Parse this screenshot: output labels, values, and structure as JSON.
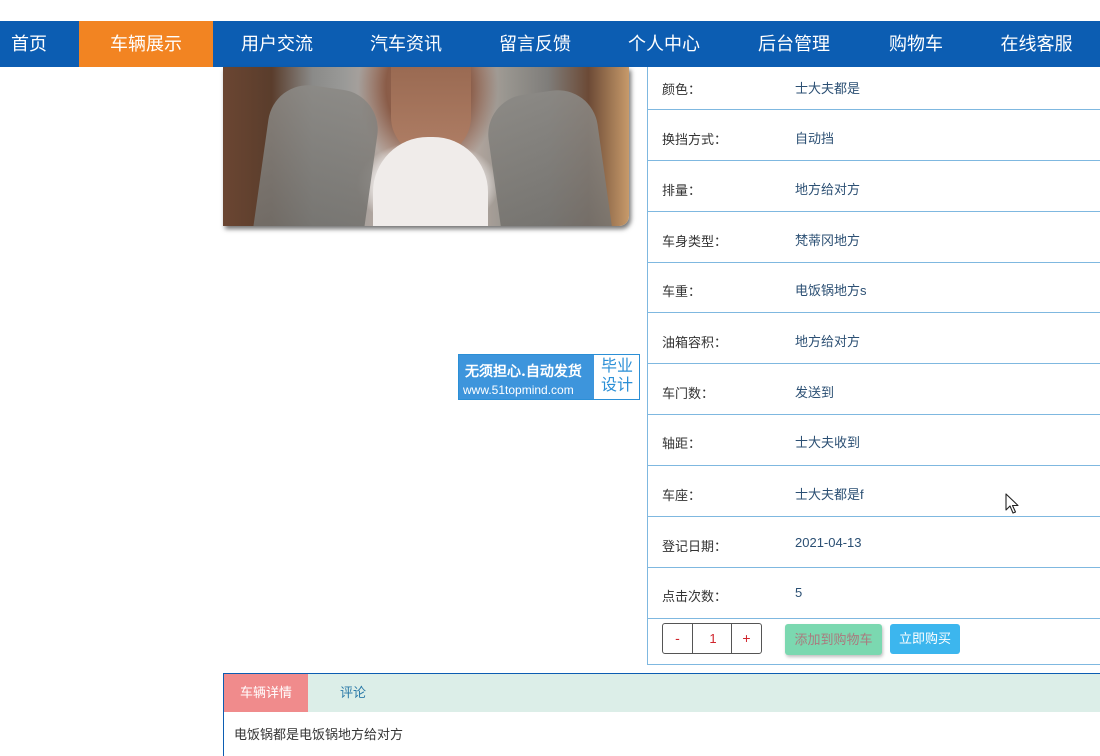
{
  "nav": {
    "items": [
      {
        "label": "首页"
      },
      {
        "label": "车辆展示"
      },
      {
        "label": "用户交流"
      },
      {
        "label": "汽车资讯"
      },
      {
        "label": "留言反馈"
      },
      {
        "label": "个人中心"
      },
      {
        "label": "后台管理"
      },
      {
        "label": "购物车"
      },
      {
        "label": "在线客服"
      }
    ],
    "active": "车辆展示",
    "bar_color": "#0c5db2",
    "active_color": "#f28422"
  },
  "watermark": {
    "line1": "无须担心.自动发货",
    "line2": "www.51topmind.com",
    "right_line1": "毕业",
    "right_line2": "设计"
  },
  "specs": [
    {
      "label": "颜色：",
      "value": "士大夫都是"
    },
    {
      "label": "换挡方式：",
      "value": "自动挡"
    },
    {
      "label": "排量：",
      "value": "地方给对方"
    },
    {
      "label": "车身类型：",
      "value": "梵蒂冈地方"
    },
    {
      "label": "车重：",
      "value": "电饭锅地方s"
    },
    {
      "label": "油箱容积：",
      "value": "地方给对方"
    },
    {
      "label": "车门数：",
      "value": "发送到"
    },
    {
      "label": "轴距：",
      "value": "士大夫收到"
    },
    {
      "label": "车座：",
      "value": "士大夫都是f"
    },
    {
      "label": "登记日期：",
      "value": "2021-04-13"
    },
    {
      "label": "点击次数：",
      "value": "5"
    }
  ],
  "quantity": {
    "minus": "-",
    "value": "1",
    "plus": "+"
  },
  "actions": {
    "add_to_cart": "添加到购物车",
    "buy_now": "立即购买"
  },
  "tabs": {
    "items": [
      {
        "label": "车辆详情"
      },
      {
        "label": "评论"
      }
    ],
    "content": "电饭锅都是电饭锅地方给对方"
  }
}
